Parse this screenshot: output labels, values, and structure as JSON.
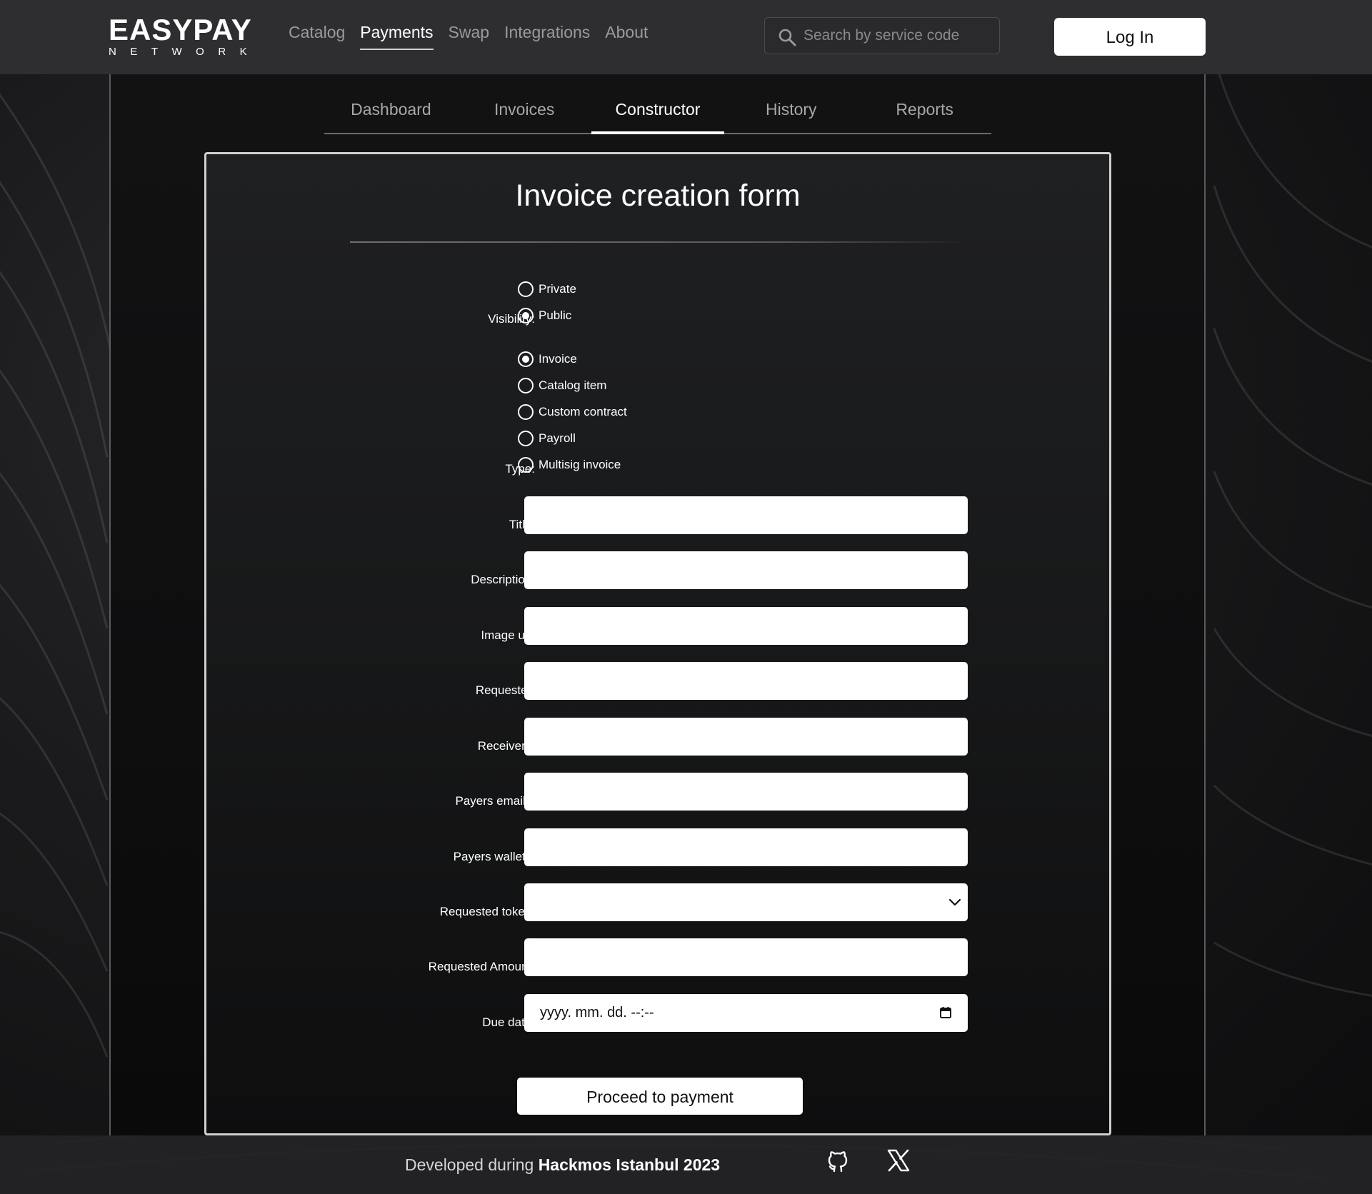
{
  "brand": {
    "name": "EASYPAY",
    "sub": "NETWORK"
  },
  "nav": {
    "items": [
      {
        "label": "Catalog"
      },
      {
        "label": "Payments"
      },
      {
        "label": "Swap"
      },
      {
        "label": "Integrations"
      },
      {
        "label": "About"
      }
    ],
    "active": "Payments"
  },
  "search": {
    "placeholder": "Search by service code",
    "value": ""
  },
  "login": {
    "label": "Log In"
  },
  "subtabs": {
    "items": [
      {
        "label": "Dashboard"
      },
      {
        "label": "Invoices"
      },
      {
        "label": "Constructor"
      },
      {
        "label": "History"
      },
      {
        "label": "Reports"
      }
    ],
    "active": "Constructor"
  },
  "form": {
    "title": "Invoice creation form",
    "visibility": {
      "label": "Visibility:",
      "options": [
        {
          "label": "Private",
          "checked": false
        },
        {
          "label": "Public",
          "checked": true
        }
      ]
    },
    "type": {
      "label": "Type:",
      "options": [
        {
          "label": "Invoice",
          "checked": true
        },
        {
          "label": "Catalog item",
          "checked": false
        },
        {
          "label": "Custom contract",
          "checked": false
        },
        {
          "label": "Payroll",
          "checked": false
        },
        {
          "label": "Multisig invoice",
          "checked": false
        }
      ]
    },
    "fields": {
      "title": {
        "label": "Title:",
        "value": ""
      },
      "description": {
        "label": "Description:",
        "value": ""
      },
      "image_url": {
        "label": "Image url:",
        "value": ""
      },
      "requester": {
        "label": "Requester:",
        "value": ""
      },
      "receivers": {
        "label": "Receivers:",
        "value": ""
      },
      "payers_emails": {
        "label": "Payers emails:",
        "value": ""
      },
      "payers_wallets": {
        "label": "Payers wallets:",
        "value": ""
      },
      "requested_token": {
        "label": "Requested token:",
        "value": ""
      },
      "requested_amount": {
        "label": "Requested Amount:",
        "value": ""
      },
      "due_date": {
        "label": "Due date:",
        "value": "yyyy. mm. dd. --:--"
      }
    },
    "submit_label": "Proceed to payment"
  },
  "footer": {
    "prefix": "Developed during ",
    "event": "Hackmos Istanbul 2023",
    "icons": [
      "github-icon",
      "x-icon"
    ]
  },
  "colors": {
    "background": "#1b1b1d",
    "card_border": "#cfcfcf",
    "accent": "#ffffff",
    "nav_inactive": "#9a9a9a"
  }
}
